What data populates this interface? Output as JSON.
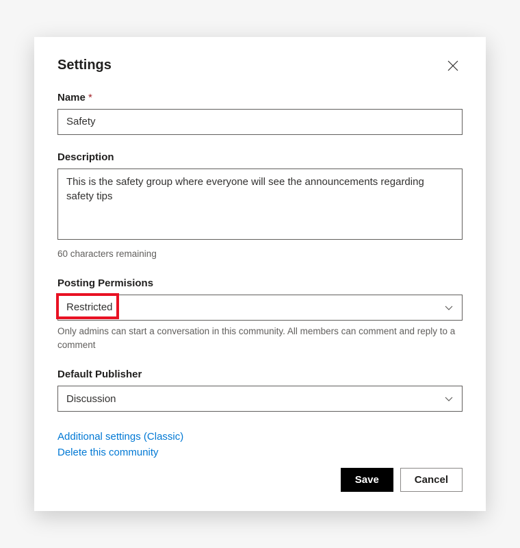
{
  "modal": {
    "title": "Settings"
  },
  "name": {
    "label": "Name",
    "required_mark": "*",
    "value": "Safety"
  },
  "description": {
    "label": "Description",
    "value": "This is the safety group where everyone will see the announcements regarding safety tips",
    "remaining": "60 characters remaining"
  },
  "posting": {
    "label": "Posting Permisions",
    "selected": "Restricted",
    "helper": "Only admins can start a conversation in this community. All members can comment and reply to a comment"
  },
  "publisher": {
    "label": "Default Publisher",
    "selected": "Discussion"
  },
  "links": {
    "additional": "Additional settings (Classic)",
    "delete": "Delete this community"
  },
  "buttons": {
    "save": "Save",
    "cancel": "Cancel"
  }
}
